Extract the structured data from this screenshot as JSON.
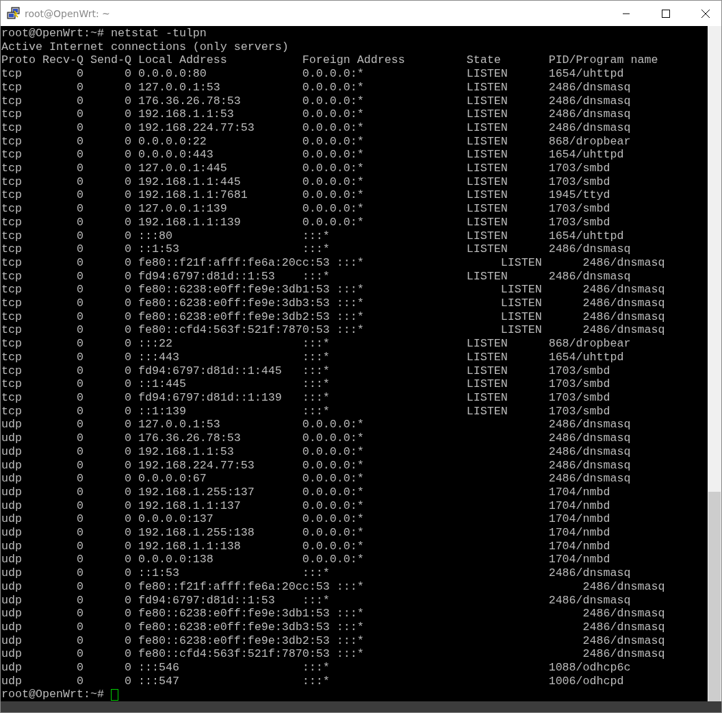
{
  "window": {
    "title": "root@OpenWrt: ~"
  },
  "terminal": {
    "lines": [
      "root@OpenWrt:~# netstat -tulpn",
      "Active Internet connections (only servers)",
      "Proto Recv-Q Send-Q Local Address           Foreign Address         State       PID/Program name",
      "tcp        0      0 0.0.0.0:80              0.0.0.0:*               LISTEN      1654/uhttpd",
      "tcp        0      0 127.0.0.1:53            0.0.0.0:*               LISTEN      2486/dnsmasq",
      "tcp        0      0 176.36.26.78:53         0.0.0.0:*               LISTEN      2486/dnsmasq",
      "tcp        0      0 192.168.1.1:53          0.0.0.0:*               LISTEN      2486/dnsmasq",
      "tcp        0      0 192.168.224.77:53       0.0.0.0:*               LISTEN      2486/dnsmasq",
      "tcp        0      0 0.0.0.0:22              0.0.0.0:*               LISTEN      868/dropbear",
      "tcp        0      0 0.0.0.0:443             0.0.0.0:*               LISTEN      1654/uhttpd",
      "tcp        0      0 127.0.0.1:445           0.0.0.0:*               LISTEN      1703/smbd",
      "tcp        0      0 192.168.1.1:445         0.0.0.0:*               LISTEN      1703/smbd",
      "tcp        0      0 192.168.1.1:7681        0.0.0.0:*               LISTEN      1945/ttyd",
      "tcp        0      0 127.0.0.1:139           0.0.0.0:*               LISTEN      1703/smbd",
      "tcp        0      0 192.168.1.1:139         0.0.0.0:*               LISTEN      1703/smbd",
      "tcp        0      0 :::80                   :::*                    LISTEN      1654/uhttpd",
      "tcp        0      0 ::1:53                  :::*                    LISTEN      2486/dnsmasq",
      "tcp        0      0 fe80::f21f:afff:fe6a:20cc:53 :::*                    LISTEN      2486/dnsmasq",
      "tcp        0      0 fd94:6797:d81d::1:53    :::*                    LISTEN      2486/dnsmasq",
      "tcp        0      0 fe80::6238:e0ff:fe9e:3db1:53 :::*                    LISTEN      2486/dnsmasq",
      "tcp        0      0 fe80::6238:e0ff:fe9e:3db3:53 :::*                    LISTEN      2486/dnsmasq",
      "tcp        0      0 fe80::6238:e0ff:fe9e:3db2:53 :::*                    LISTEN      2486/dnsmasq",
      "tcp        0      0 fe80::cfd4:563f:521f:7870:53 :::*                    LISTEN      2486/dnsmasq",
      "tcp        0      0 :::22                   :::*                    LISTEN      868/dropbear",
      "tcp        0      0 :::443                  :::*                    LISTEN      1654/uhttpd",
      "tcp        0      0 fd94:6797:d81d::1:445   :::*                    LISTEN      1703/smbd",
      "tcp        0      0 ::1:445                 :::*                    LISTEN      1703/smbd",
      "tcp        0      0 fd94:6797:d81d::1:139   :::*                    LISTEN      1703/smbd",
      "tcp        0      0 ::1:139                 :::*                    LISTEN      1703/smbd",
      "udp        0      0 127.0.0.1:53            0.0.0.0:*                           2486/dnsmasq",
      "udp        0      0 176.36.26.78:53         0.0.0.0:*                           2486/dnsmasq",
      "udp        0      0 192.168.1.1:53          0.0.0.0:*                           2486/dnsmasq",
      "udp        0      0 192.168.224.77:53       0.0.0.0:*                           2486/dnsmasq",
      "udp        0      0 0.0.0.0:67              0.0.0.0:*                           2486/dnsmasq",
      "udp        0      0 192.168.1.255:137       0.0.0.0:*                           1704/nmbd",
      "udp        0      0 192.168.1.1:137         0.0.0.0:*                           1704/nmbd",
      "udp        0      0 0.0.0.0:137             0.0.0.0:*                           1704/nmbd",
      "udp        0      0 192.168.1.255:138       0.0.0.0:*                           1704/nmbd",
      "udp        0      0 192.168.1.1:138         0.0.0.0:*                           1704/nmbd",
      "udp        0      0 0.0.0.0:138             0.0.0.0:*                           1704/nmbd",
      "udp        0      0 ::1:53                  :::*                                2486/dnsmasq",
      "udp        0      0 fe80::f21f:afff:fe6a:20cc:53 :::*                                2486/dnsmasq",
      "udp        0      0 fd94:6797:d81d::1:53    :::*                                2486/dnsmasq",
      "udp        0      0 fe80::6238:e0ff:fe9e:3db1:53 :::*                                2486/dnsmasq",
      "udp        0      0 fe80::6238:e0ff:fe9e:3db3:53 :::*                                2486/dnsmasq",
      "udp        0      0 fe80::6238:e0ff:fe9e:3db2:53 :::*                                2486/dnsmasq",
      "udp        0      0 fe80::cfd4:563f:521f:7870:53 :::*                                2486/dnsmasq",
      "udp        0      0 :::546                  :::*                                1088/odhcp6c",
      "udp        0      0 :::547                  :::*                                1006/odhcpd"
    ],
    "prompt": "root@OpenWrt:~#"
  }
}
